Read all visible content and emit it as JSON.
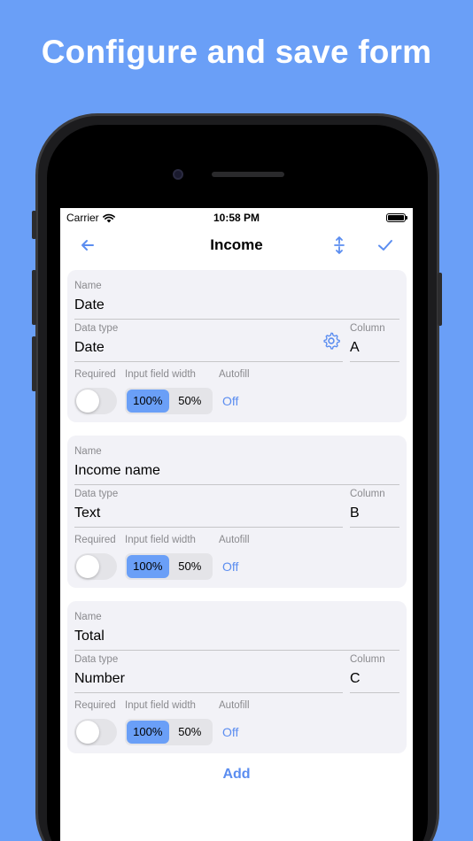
{
  "headline": "Configure and save form",
  "status": {
    "carrier": "Carrier",
    "time": "10:58 PM"
  },
  "nav": {
    "title": "Income",
    "back_icon": "arrow-left-icon",
    "reorder_icon": "vertical-arrows-icon",
    "confirm_icon": "checkmark-icon"
  },
  "labels": {
    "name": "Name",
    "data_type": "Data type",
    "column": "Column",
    "required": "Required",
    "input_field_width": "Input field width",
    "autofill": "Autofill"
  },
  "cards": [
    {
      "name": "Date",
      "data_type": "Date",
      "column": "A",
      "required": false,
      "width_options": [
        "100%",
        "50%"
      ],
      "width_selected": "100%",
      "autofill": "Off",
      "has_settings": true
    },
    {
      "name": "Income name",
      "data_type": "Text",
      "column": "B",
      "required": false,
      "width_options": [
        "100%",
        "50%"
      ],
      "width_selected": "100%",
      "autofill": "Off",
      "has_settings": false
    },
    {
      "name": "Total",
      "data_type": "Number",
      "column": "C",
      "required": false,
      "width_options": [
        "100%",
        "50%"
      ],
      "width_selected": "100%",
      "autofill": "Off",
      "has_settings": false
    }
  ],
  "add_label": "Add",
  "colors": {
    "accent": "#5b8df0",
    "background": "#6a9ff7",
    "card": "#f2f2f7"
  }
}
